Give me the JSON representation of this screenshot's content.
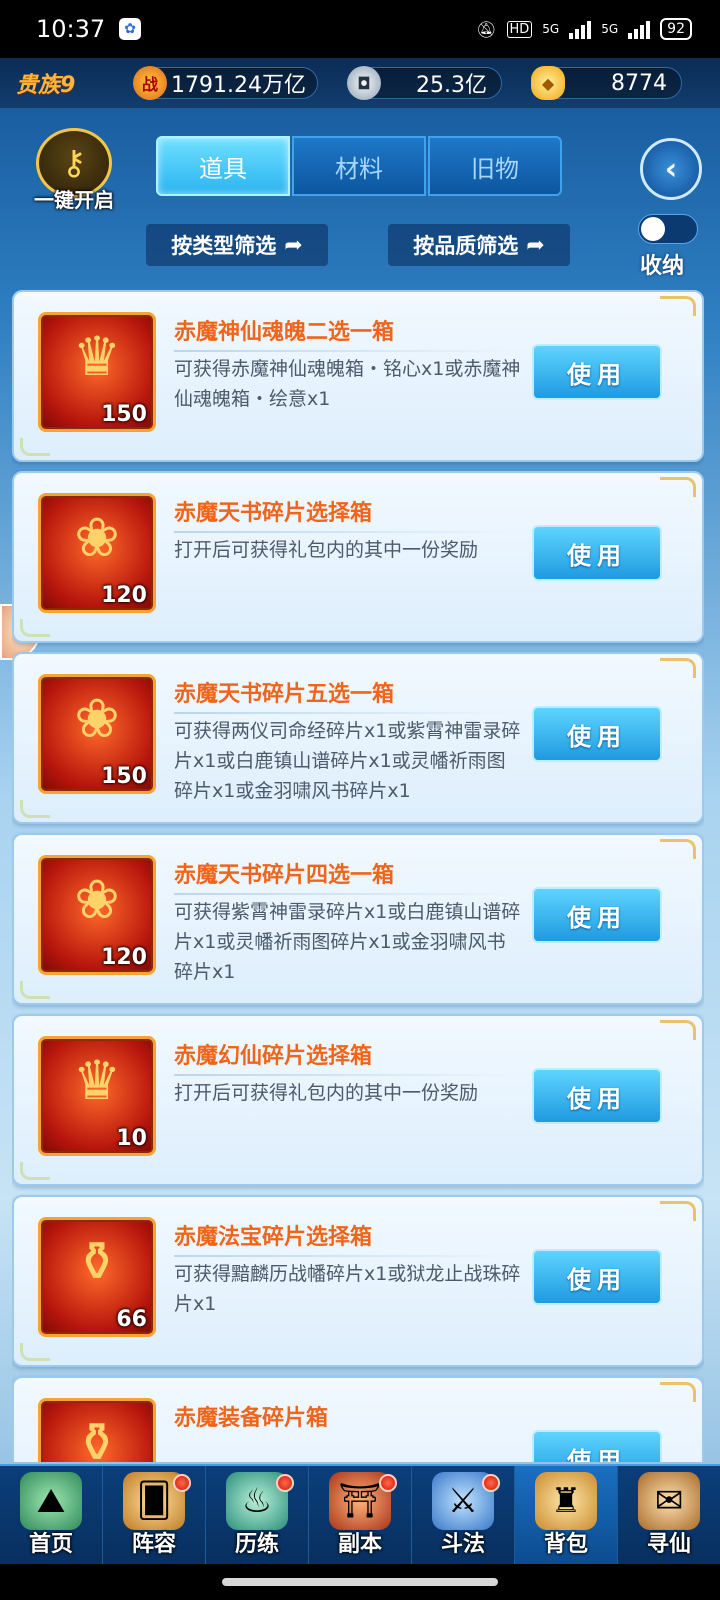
{
  "status_bar": {
    "time": "10:37",
    "app_icon": "baidu-icon",
    "hd_label": "HD",
    "signal1_label": "5G",
    "signal2_label": "5G",
    "battery": "92"
  },
  "resources": {
    "vip_label": "贵族9",
    "power_icon_text": "战",
    "power_value": "1791.24万亿",
    "coin_value": "25.3亿",
    "gold_value": "8774"
  },
  "controls": {
    "one_key_open": "一键开启",
    "tabs": [
      {
        "label": "道具",
        "active": true
      },
      {
        "label": "材料",
        "active": false
      },
      {
        "label": "旧物",
        "active": false
      }
    ],
    "back_icon": "back-arrow-icon",
    "filter_type": "按类型筛选",
    "filter_quality": "按品质筛选",
    "toggle_label": "收纳"
  },
  "items": [
    {
      "name": "赤魔神仙魂魄二选一箱",
      "desc": "可获得赤魔神仙魂魄箱・铭心x1或赤魔神仙魂魄箱・绘意x1",
      "count": "150",
      "use": "使用",
      "icon": "hero-chest-icon"
    },
    {
      "name": "赤魔天书碎片选择箱",
      "desc": "打开后可获得礼包内的其中一份奖励",
      "count": "120",
      "use": "使用",
      "icon": "red-pouch-icon"
    },
    {
      "name": "赤魔天书碎片五选一箱",
      "desc": "可获得两仪司命经碎片x1或紫霄神雷录碎片x1或白鹿镇山谱碎片x1或灵幡祈雨图碎片x1或金羽啸风书碎片x1",
      "count": "150",
      "use": "使用",
      "icon": "red-pouch-icon"
    },
    {
      "name": "赤魔天书碎片四选一箱",
      "desc": "可获得紫霄神雷录碎片x1或白鹿镇山谱碎片x1或灵幡祈雨图碎片x1或金羽啸风书碎片x1",
      "count": "120",
      "use": "使用",
      "icon": "red-pouch-icon"
    },
    {
      "name": "赤魔幻仙碎片选择箱",
      "desc": "打开后可获得礼包内的其中一份奖励",
      "count": "10",
      "use": "使用",
      "icon": "hero-chest-icon"
    },
    {
      "name": "赤魔法宝碎片选择箱",
      "desc": "可获得黯麟历战幡碎片x1或狱龙止战珠碎片x1",
      "count": "66",
      "use": "使用",
      "icon": "treasure-chest-icon"
    },
    {
      "name": "赤魔装备碎片箱",
      "desc": "",
      "count": "",
      "use": "使用",
      "icon": "treasure-chest-icon"
    }
  ],
  "nav": [
    {
      "label": "首页",
      "icon": "home-island-icon",
      "dot": false,
      "active": false
    },
    {
      "label": "阵容",
      "icon": "cards-icon",
      "dot": true,
      "active": false
    },
    {
      "label": "历练",
      "icon": "gourd-icon",
      "dot": true,
      "active": false
    },
    {
      "label": "副本",
      "icon": "gate-icon",
      "dot": true,
      "active": false
    },
    {
      "label": "斗法",
      "icon": "swords-icon",
      "dot": true,
      "active": false
    },
    {
      "label": "背包",
      "icon": "bag-icon",
      "dot": false,
      "active": true
    },
    {
      "label": "寻仙",
      "icon": "scroll-icon",
      "dot": false,
      "active": false
    }
  ]
}
